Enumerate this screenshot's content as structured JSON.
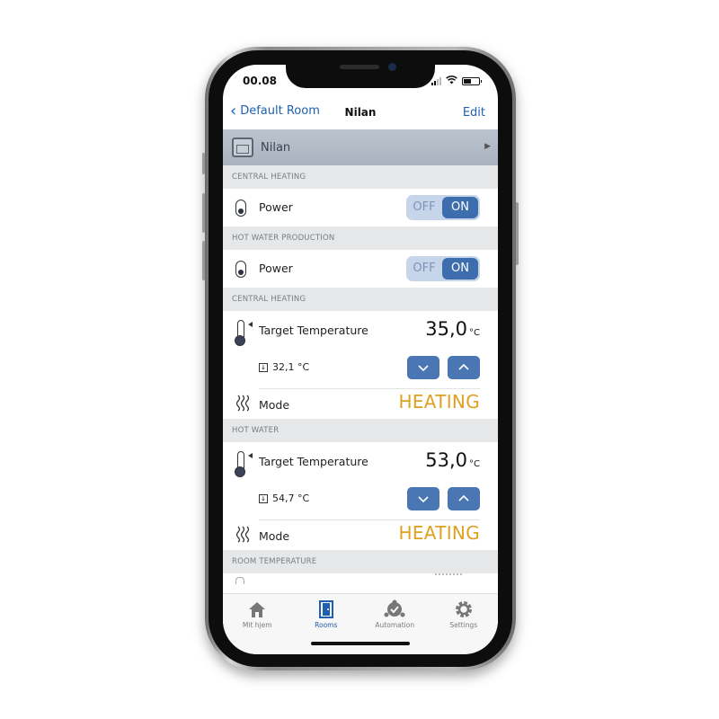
{
  "status": {
    "time": "00.08",
    "battery_level": 0.55
  },
  "nav": {
    "back_label": "Default Room",
    "title": "Nilan",
    "edit_label": "Edit"
  },
  "device": {
    "name": "Nilan"
  },
  "sections": {
    "central_heating_power": "CENTRAL HEATING",
    "hot_water_production": "HOT WATER PRODUCTION",
    "central_heating_temp": "CENTRAL HEATING",
    "hot_water": "HOT WATER",
    "room_temperature": "ROOM TEMPERATURE"
  },
  "power_rows": [
    {
      "label": "Power",
      "off_label": "OFF",
      "on_label": "ON",
      "state": "ON"
    },
    {
      "label": "Power",
      "off_label": "OFF",
      "on_label": "ON",
      "state": "ON"
    }
  ],
  "temp_blocks": [
    {
      "label": "Target Temperature",
      "value": "35,0",
      "unit": "°C",
      "measured": "32,1 °C",
      "mode_label": "Mode",
      "mode_value": "HEATING"
    },
    {
      "label": "Target Temperature",
      "value": "53,0",
      "unit": "°C",
      "measured": "54,7 °C",
      "mode_label": "Mode",
      "mode_value": "HEATING"
    }
  ],
  "tabs": [
    {
      "label": "Mit hjem",
      "icon": "home-icon",
      "active": false
    },
    {
      "label": "Rooms",
      "icon": "door-icon",
      "active": true
    },
    {
      "label": "Automation",
      "icon": "automation-icon",
      "active": false
    },
    {
      "label": "Settings",
      "icon": "gear-icon",
      "active": false
    }
  ],
  "colors": {
    "accent": "#1f5fb0",
    "toggle_on": "#3d6dad",
    "mode": "#e0a021",
    "section_bg": "#e6e7e9"
  }
}
